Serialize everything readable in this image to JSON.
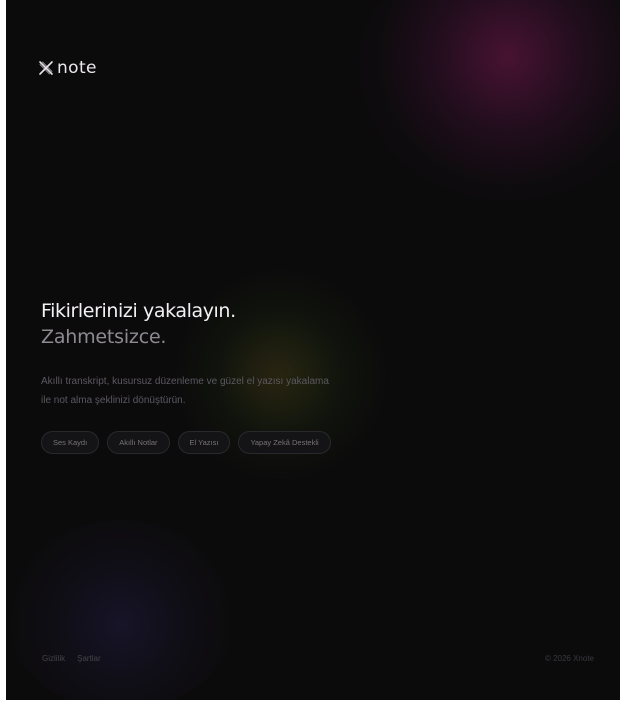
{
  "brand": {
    "name": "Xnote",
    "logo_text": "note",
    "mark_icon": "x-logo-icon"
  },
  "hero": {
    "headline": "Fikirlerinizi yakalayın.",
    "subheadline": "Zahmetsizce.",
    "description": "Akıllı transkript, kusursuz düzenleme ve güzel el yazısı yakalama ile not alma şeklinizi dönüştürün."
  },
  "features": [
    {
      "label": "Ses Kaydı"
    },
    {
      "label": "Akıllı Notlar"
    },
    {
      "label": "El Yazısı"
    },
    {
      "label": "Yapay Zekâ Destekli"
    }
  ],
  "footer": {
    "links": [
      {
        "label": "Gizlilik"
      },
      {
        "label": "Şartlar"
      }
    ],
    "copyright": "© 2026 Xnote"
  },
  "colors": {
    "background": "#0c0b0c",
    "headline": "#f2f0f3",
    "subheadline": "#8e8a92",
    "glow_top_right": "#781850",
    "glow_bottom_left": "#1e1a3a",
    "glow_center": "#243810"
  }
}
